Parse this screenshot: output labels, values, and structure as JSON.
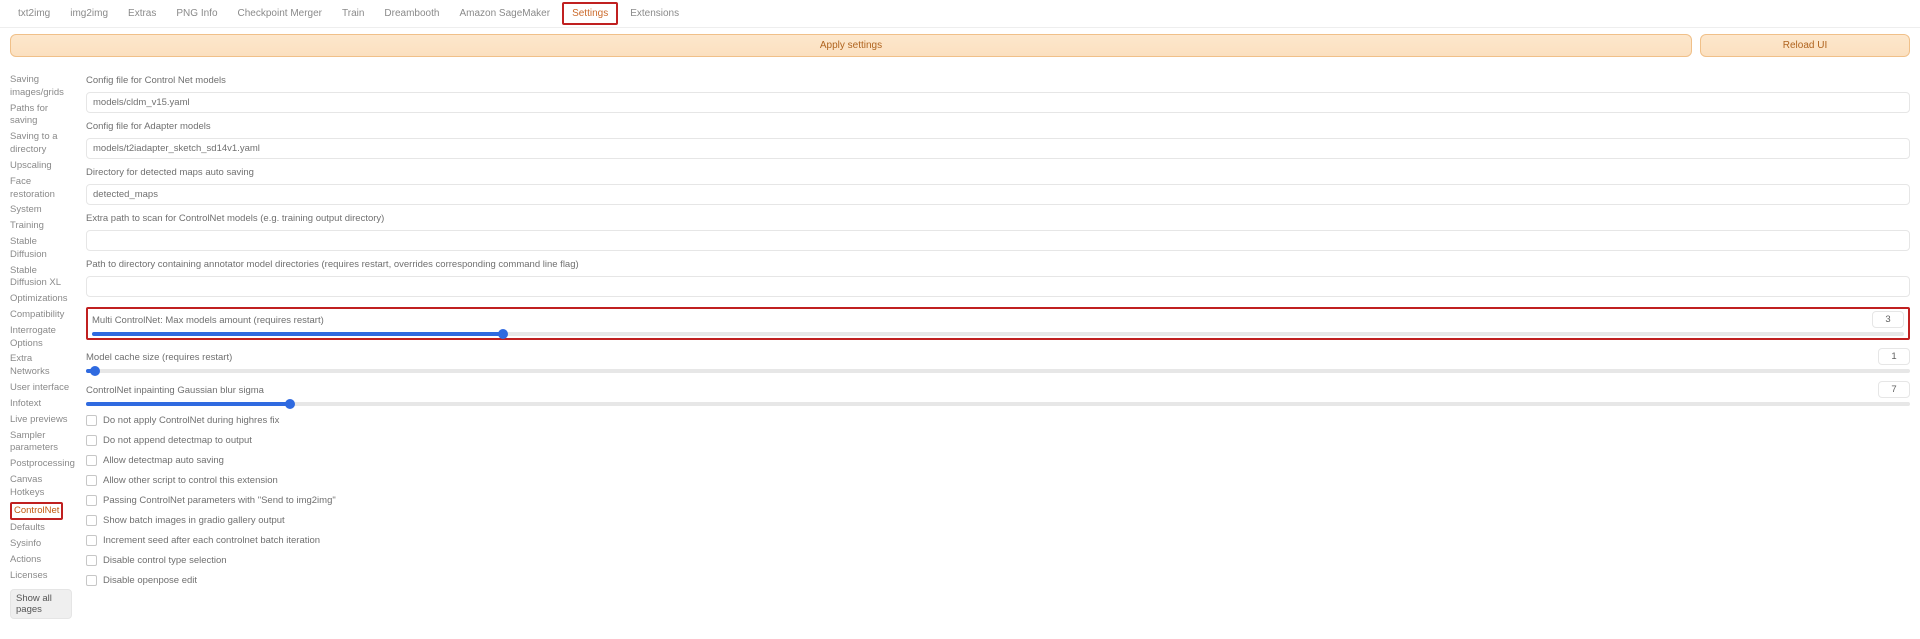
{
  "tabs": {
    "items": [
      "txt2img",
      "img2img",
      "Extras",
      "PNG Info",
      "Checkpoint Merger",
      "Train",
      "Dreambooth",
      "Amazon SageMaker",
      "Settings",
      "Extensions"
    ],
    "active_index": 8
  },
  "buttons": {
    "apply": "Apply settings",
    "reload": "Reload UI"
  },
  "sidebar": {
    "items": [
      "Saving images/grids",
      "Paths for saving",
      "Saving to a directory",
      "Upscaling",
      "Face restoration",
      "System",
      "Training",
      "Stable Diffusion",
      "Stable Diffusion XL",
      "Optimizations",
      "Compatibility",
      "Interrogate Options",
      "Extra Networks",
      "User interface",
      "Infotext",
      "Live previews",
      "Sampler parameters",
      "Postprocessing",
      "Canvas Hotkeys",
      "ControlNet",
      "Defaults",
      "Sysinfo",
      "Actions",
      "Licenses"
    ],
    "active_index": 19,
    "show_all": "Show all pages"
  },
  "fields": {
    "config_cnet_label": "Config file for Control Net models",
    "config_cnet_value": "models/cldm_v15.yaml",
    "config_adapter_label": "Config file for Adapter models",
    "config_adapter_value": "models/t2iadapter_sketch_sd14v1.yaml",
    "detected_dir_label": "Directory for detected maps auto saving",
    "detected_dir_value": "detected_maps",
    "extra_path_label": "Extra path to scan for ControlNet models (e.g. training output directory)",
    "extra_path_value": "",
    "annotator_path_label": "Path to directory containing annotator model directories (requires restart, overrides corresponding command line flag)",
    "annotator_path_value": ""
  },
  "sliders": {
    "multi": {
      "label": "Multi ControlNet: Max models amount (requires restart)",
      "value": "3",
      "fill_pct": 22.7
    },
    "cache": {
      "label": "Model cache size (requires restart)",
      "value": "1",
      "fill_pct": 0.5
    },
    "blur": {
      "label": "ControlNet inpainting Gaussian blur sigma",
      "value": "7",
      "fill_pct": 11.2
    }
  },
  "checks": {
    "items": [
      "Do not apply ControlNet during highres fix",
      "Do not append detectmap to output",
      "Allow detectmap auto saving",
      "Allow other script to control this extension",
      "Passing ControlNet parameters with \"Send to img2img\"",
      "Show batch images in gradio gallery output",
      "Increment seed after each controlnet batch iteration",
      "Disable control type selection",
      "Disable openpose edit"
    ]
  }
}
